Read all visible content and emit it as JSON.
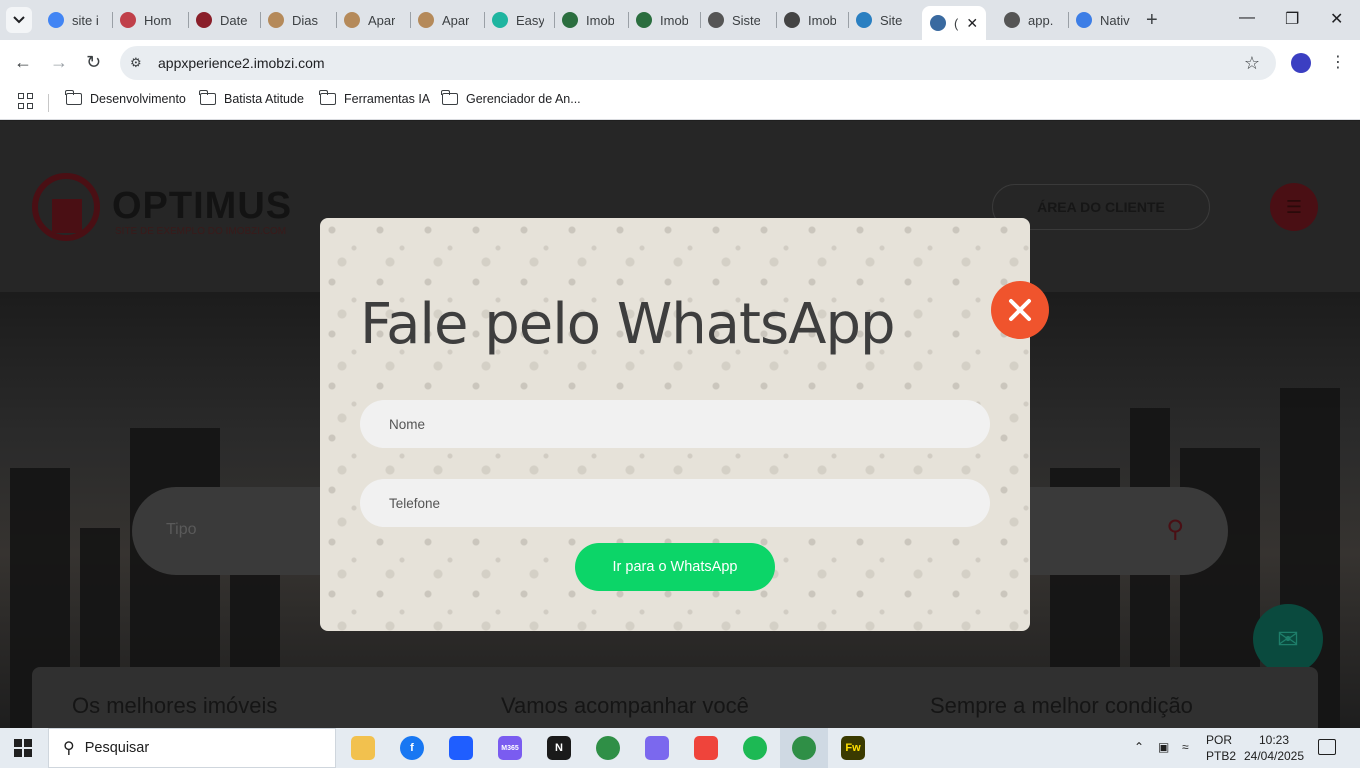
{
  "browser": {
    "tabs": [
      {
        "label": "site i",
        "color": "#4285f4"
      },
      {
        "label": "Hom",
        "color": "#c0404a"
      },
      {
        "label": "Date",
        "color": "#8a1f2a"
      },
      {
        "label": "Dias",
        "color": "#b58a5a"
      },
      {
        "label": "Apar",
        "color": "#b58a5a"
      },
      {
        "label": "Apar",
        "color": "#b58a5a"
      },
      {
        "label": "Easy",
        "color": "#1fb5a0"
      },
      {
        "label": "Imob",
        "color": "#2b6e3f"
      },
      {
        "label": "Imob",
        "color": "#2b6e3f"
      },
      {
        "label": "Siste",
        "color": "#555555"
      },
      {
        "label": "Imob",
        "color": "#444444"
      },
      {
        "label": "Site",
        "color": "#2a7fc1"
      },
      {
        "label": "(",
        "color": "#3a6aa0"
      },
      {
        "label": "app.",
        "color": "#555555"
      },
      {
        "label": "Nativ",
        "color": "#3d7ee6"
      }
    ],
    "new_tab": "+",
    "url": "appxperience2.imobzi.com",
    "bookmarks": [
      "Desenvolvimento",
      "Batista Atitude",
      "Ferramentas IA",
      "Gerenciador de An..."
    ]
  },
  "site": {
    "logo": "OPTIMUS",
    "logo_subtitle": "SITE DE EXEMPLO DO IMOBZI.COM",
    "client_area": "ÁREA DO CLIENTE",
    "search_placeholder": "Tipo",
    "features": [
      "Os melhores imóveis",
      "Vamos acompanhar você",
      "Sempre a melhor condição"
    ]
  },
  "modal": {
    "title": "Fale pelo WhatsApp",
    "name_placeholder": "Nome",
    "phone_placeholder": "Telefone",
    "submit": "Ir para o WhatsApp",
    "accent": "#0cd568",
    "close_color": "#f0542d"
  },
  "taskbar": {
    "search": "Pesquisar",
    "lang_line1": "POR",
    "lang_line2": "PTB2",
    "time": "10:23",
    "date": "24/04/2025",
    "apps": [
      {
        "name": "file-explorer",
        "label": "",
        "color": "#f2c14e"
      },
      {
        "name": "facebook",
        "label": "f",
        "color": "#1877f2"
      },
      {
        "name": "dropbox",
        "label": "",
        "color": "#1f5eff"
      },
      {
        "name": "m365",
        "label": "M365",
        "color": "#7a5cf0"
      },
      {
        "name": "notion",
        "label": "N",
        "color": "#1a1a1a"
      },
      {
        "name": "chrome",
        "label": "",
        "color": "#2f8f46"
      },
      {
        "name": "clickup",
        "label": "",
        "color": "#7b68ee"
      },
      {
        "name": "anydesk",
        "label": "",
        "color": "#ef443b"
      },
      {
        "name": "spotify",
        "label": "",
        "color": "#1db954"
      },
      {
        "name": "chrome-profile",
        "label": "",
        "color": "#2f8f46"
      },
      {
        "name": "fireworks",
        "label": "Fw",
        "color": "#3a3a00"
      }
    ]
  }
}
